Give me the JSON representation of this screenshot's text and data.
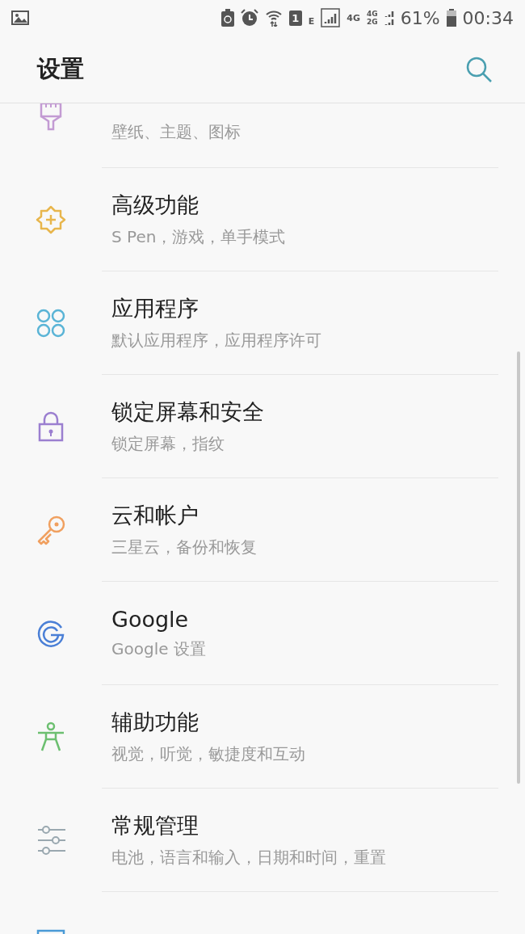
{
  "status_bar": {
    "sim_slot": "1",
    "network_e": "E",
    "network_4g": "4G",
    "dual_top": "4G",
    "dual_bottom": "2G",
    "battery": "61%",
    "time": "00:34"
  },
  "header": {
    "title": "设置"
  },
  "items": [
    {
      "subtitle": "壁纸、主题、图标"
    },
    {
      "title": "高级功能",
      "subtitle": "S Pen，游戏，单手模式"
    },
    {
      "title": "应用程序",
      "subtitle": "默认应用程序，应用程序许可"
    },
    {
      "title": "锁定屏幕和安全",
      "subtitle": "锁定屏幕，指纹"
    },
    {
      "title": "云和帐户",
      "subtitle": "三星云，备份和恢复"
    },
    {
      "title": "Google",
      "subtitle": "Google 设置"
    },
    {
      "title": "辅助功能",
      "subtitle": "视觉，听觉，敏捷度和互动"
    },
    {
      "title": "常规管理",
      "subtitle": "电池，语言和输入，日期和时间，重置"
    }
  ]
}
